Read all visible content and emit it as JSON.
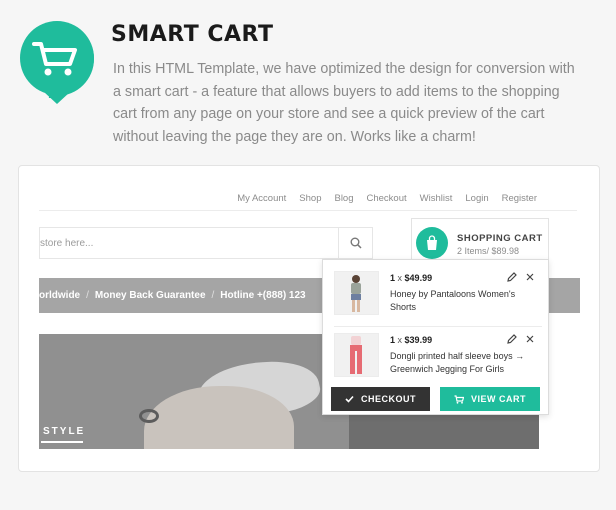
{
  "feature": {
    "title": "SMART CART",
    "description": "In this HTML Template, we have optimized the design for conversion with a smart cart - a feature that allows buyers to add items to the shopping cart from any page on your store and see a quick preview of the cart without leaving the page they are on. Works like a charm!",
    "icon": "shopping-cart-icon",
    "accent_color": "#1fbc9c"
  },
  "preview": {
    "topnav": [
      "My Account",
      "Shop",
      "Blog",
      "Checkout",
      "Wishlist",
      "Login",
      "Register"
    ],
    "search": {
      "placeholder": "store here..."
    },
    "cart": {
      "title": "SHOPPING CART",
      "summary": "2 Items/ $89.98"
    },
    "info_bar": {
      "items": [
        "orldwide",
        "Money Back Guarantee",
        "Hotline +(888) 123"
      ],
      "separator": "/"
    },
    "hero": {
      "label": "STYLE"
    },
    "dropdown": {
      "items": [
        {
          "qty": "1",
          "times": "x",
          "price": "$49.99",
          "name": "Honey by Pantaloons Women's Shorts"
        },
        {
          "qty": "1",
          "times": "x",
          "price": "$39.99",
          "name": "Dongli printed half sleeve boys → Greenwich Jegging For Girls"
        }
      ],
      "checkout_label": "CHECKOUT",
      "view_cart_label": "VIEW CART"
    }
  }
}
